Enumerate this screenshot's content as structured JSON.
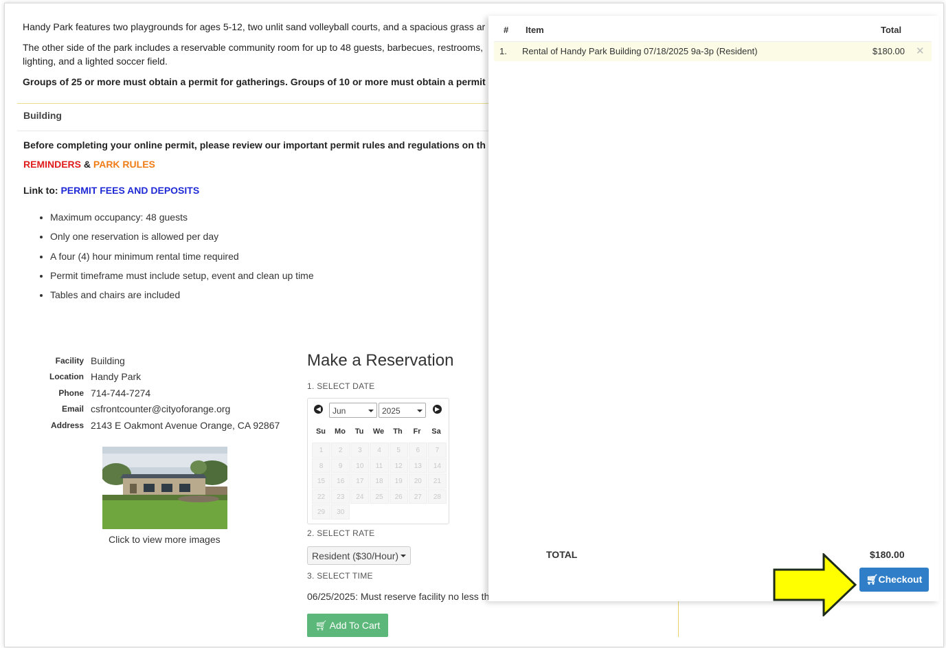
{
  "intro": {
    "line1": "Handy Park features two playgrounds for ages 5-12, two unlit sand volleyball courts, and a spacious grass ar",
    "line2a": "The other side of the park includes a reservable community room for up to 48 guests, barbecues, restrooms,",
    "line2b": "lighting, and a lighted soccer field.",
    "line3": "Groups of 25 or more must obtain a permit for gatherings. Groups of 10 or more must obtain a permit"
  },
  "section_title": "Building",
  "permit_notice": "Before completing your online permit, please review our important permit rules and regulations on th",
  "links": {
    "reminders": "REMINDERS",
    "amp": " & ",
    "park_rules": "PARK RULES",
    "link_to": "Link to: ",
    "permit_fees": "PERMIT FEES AND DEPOSITS"
  },
  "rules": [
    "Maximum occupancy: 48 guests",
    "Only one reservation is allowed per day",
    "A four (4) hour minimum rental time required",
    "Permit timeframe must include setup, event and clean up time",
    "Tables and chairs are included"
  ],
  "facility": {
    "facility_label": "Facility",
    "facility_value": "Building",
    "location_label": "Location",
    "location_value": "Handy Park",
    "phone_label": "Phone",
    "phone_value": "714-744-7274",
    "email_label": "Email",
    "email_value": "csfrontcounter@cityoforange.org",
    "address_label": "Address",
    "address_value": "2143 E Oakmont Avenue Orange, CA 92867",
    "image_caption": "Click to view more images"
  },
  "reservation": {
    "title": "Make a Reservation",
    "step1": "1. SELECT DATE",
    "month": "Jun",
    "year": "2025",
    "weekdays": [
      "Su",
      "Mo",
      "Tu",
      "We",
      "Th",
      "Fr",
      "Sa"
    ],
    "days": [
      "1",
      "2",
      "3",
      "4",
      "5",
      "6",
      "7",
      "8",
      "9",
      "10",
      "11",
      "12",
      "13",
      "14",
      "15",
      "16",
      "17",
      "18",
      "19",
      "20",
      "21",
      "22",
      "23",
      "24",
      "25",
      "26",
      "27",
      "28",
      "29",
      "30"
    ],
    "step2": "2. SELECT RATE",
    "rate": "Resident ($30/Hour)",
    "step3": "3. SELECT TIME",
    "time_message": "06/25/2025: Must reserve facility no less th",
    "add_to_cart": "Add To Cart"
  },
  "cart": {
    "col_num": "#",
    "col_item": "Item",
    "col_total": "Total",
    "rows": [
      {
        "num": "1.",
        "item": "Rental of Handy Park Building 07/18/2025 9a-3p (Resident)",
        "total": "$180.00"
      }
    ],
    "total_label": "TOTAL",
    "total_value": "$180.00",
    "checkout": "Checkout"
  },
  "colors": {
    "checkout": "#2f7ec7",
    "add_to_cart": "#5cb87a",
    "arrow_fill": "#ffff00",
    "reminders": "#e01b1b",
    "park_rules": "#f07c16",
    "permit_fees": "#1f2ad6"
  }
}
